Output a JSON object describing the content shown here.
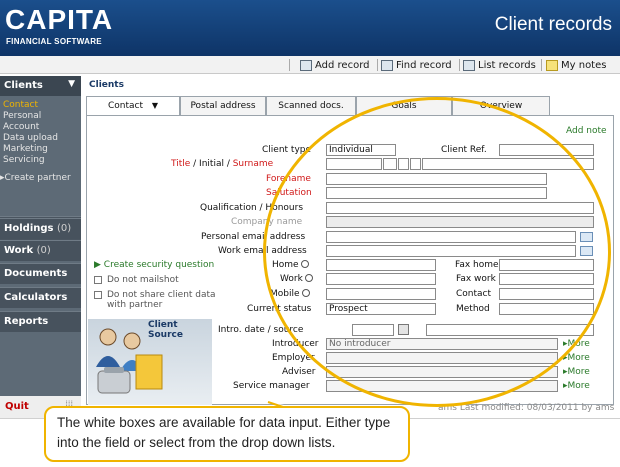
{
  "app": {
    "logo_main": "CAPITA",
    "logo_sub": "FINANCIAL SOFTWARE",
    "title": "Client records"
  },
  "toolbar": {
    "add_record": "Add record",
    "find_record": "Find record",
    "list_records": "List records",
    "my_notes": "My notes"
  },
  "sidebar": {
    "header": "Clients",
    "subitems": [
      "Contact",
      "Personal",
      "Account",
      "Data upload",
      "Marketing",
      "Servicing"
    ],
    "create_partner": "▸Create partner",
    "holdings": "Holdings",
    "holdings_count": "(0)",
    "work": "Work",
    "work_count": "(0)",
    "documents": "Documents",
    "calculators": "Calculators",
    "reports": "Reports",
    "quit": "Quit"
  },
  "breadcrumb": "Clients",
  "tabs": [
    "Contact",
    "Postal address",
    "Scanned docs.",
    "Goals",
    "Overview"
  ],
  "form": {
    "add_note": "Add note",
    "client_type_label": "Client type",
    "client_type_value": "Individual",
    "client_ref_label": "Client Ref.",
    "title_label": "Title",
    "initial_label": " / Initial / ",
    "surname_label": "Surname",
    "forename_label": "Forename",
    "salutation_label": "Salutation",
    "qualification_label": "Qualification / Honours",
    "company_label": "Company name",
    "personal_email_label": "Personal email address",
    "work_email_label": "Work email address",
    "create_security_q": "Create security question",
    "home_label": "Home",
    "work_label": "Work",
    "mobile_label": "Mobile",
    "fax_home_label": "Fax home",
    "fax_work_label": "Fax work",
    "contact_label": "Contact",
    "method_label": "Method",
    "current_status_label": "Current status",
    "current_status_value": "Prospect",
    "not_mailshot": "Do not mailshot",
    "not_share_1": "Do not share client data",
    "not_share_2": "with partner",
    "client_source_1": "Client",
    "client_source_2": "Source",
    "intro_date_label": "Intro. date / source",
    "introducer_label": "Introducer",
    "introducer_value": "No introducer",
    "employer_label": "Employer",
    "adviser_label": "Adviser",
    "service_manager_label": "Service manager",
    "more": "▸More"
  },
  "status_bar": "ams Last modified: 08/03/2011 by ams",
  "callout": {
    "line1": "The white boxes are available for data input. Either type",
    "line2": "into the field or select from the drop down lists."
  },
  "colors": {
    "header": "#1b4f8c",
    "accent": "#f0b400",
    "sidebar": "#5d6a76",
    "label_required": "#d01818"
  }
}
